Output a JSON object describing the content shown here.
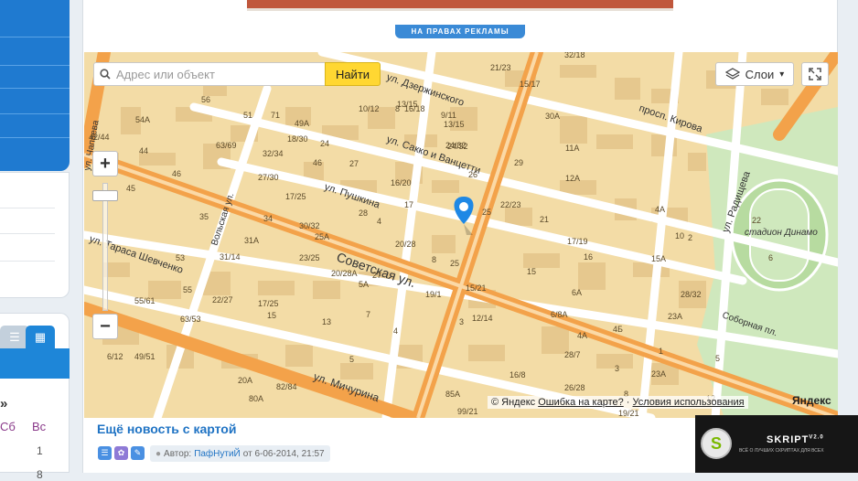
{
  "ad": {
    "label": "НА ПРАВАХ РЕКЛАМЫ"
  },
  "map": {
    "search_placeholder": "Адрес или объект",
    "search_button": "Найти",
    "layers_button": "Слои",
    "zoom_in": "+",
    "zoom_out": "−",
    "copyright_prefix": "© Яндекс",
    "error_link": "Ошибка на карте?",
    "terms_link": "Условия использования",
    "logo_text": "Яндекс",
    "streets": [
      "ул. Дзержинского",
      "ул. Сакко и Ванцетти",
      "ул. Пушкина",
      "Советская ул.",
      "ул. Мичурина",
      "ул. Тараса Шевченко",
      "Вольская ул.",
      "просп. Кирова",
      "ул. Радищева",
      "Соборная пл.",
      "стадион Динамо",
      "ул. Чапаева"
    ],
    "house_numbers": [
      "54А",
      "56",
      "51",
      "71",
      "63/69",
      "44",
      "46",
      "45",
      "35",
      "31А",
      "55/61",
      "53",
      "55",
      "63/53",
      "32/34",
      "27/30",
      "17/25",
      "49А",
      "46",
      "24",
      "27",
      "30/32",
      "34",
      "28",
      "20/28",
      "20/28А",
      "23/25",
      "25А",
      "27",
      "25",
      "19/1",
      "15/21",
      "12/14",
      "16/20",
      "17",
      "4",
      "8",
      "8",
      "5А",
      "5",
      "20А",
      "82/84",
      "80А",
      "49/51",
      "6/12",
      "42/44",
      "10/12",
      "16/18",
      "13/15",
      "9/11",
      "24/32",
      "22/23",
      "21",
      "17/19",
      "29",
      "32/18",
      "21/23",
      "11А",
      "30А",
      "12А",
      "15",
      "16",
      "15А",
      "10",
      "4А",
      "2",
      "23А",
      "28/32",
      "6А",
      "6/8А",
      "4А",
      "4Б",
      "26/28",
      "19/21",
      "22",
      "6",
      "1",
      "5",
      "3",
      "31/14",
      "22/27",
      "17/25",
      "15",
      "13",
      "7",
      "4",
      "23А",
      "85А",
      "99/21",
      "28/7",
      "8",
      "16/8",
      "12",
      "25",
      "3",
      "13/15",
      "15/17",
      "24/32",
      "26",
      "18/30"
    ]
  },
  "post": {
    "title": "Ещё новость с картой",
    "author_prefix": "Автор:",
    "author": "ПафНутиЙ",
    "date_text": "от 6-06-2014, 21:57"
  },
  "sidebar": {
    "calendar_arrow": "»",
    "sat": "Сб",
    "sun": "Вс",
    "day1": "1",
    "day2": "8"
  },
  "skript": {
    "name": "SKRIPT",
    "version": "V2.0",
    "sub": "ВСЁ О ЛУЧШИХ СКРИПТАХ ДЛЯ ВСЕХ"
  },
  "colors": {
    "accent": "#1f7ad0",
    "search_button": "#ffd732",
    "road_main": "#f5a64a",
    "block": "#f3d9a4",
    "building": "#e6c890",
    "park": "#c8e6b8"
  }
}
